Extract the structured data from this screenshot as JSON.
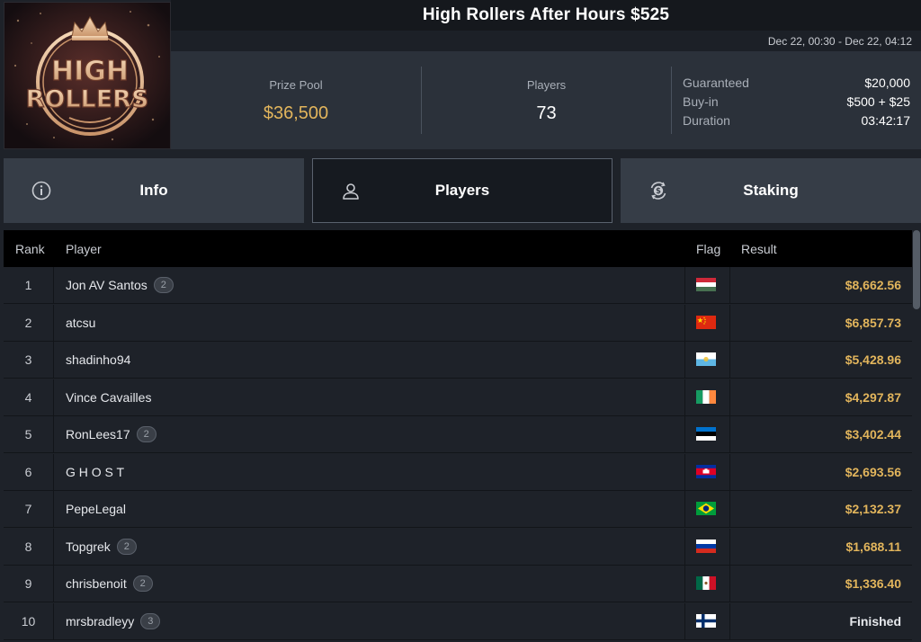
{
  "logo": {
    "text_line1": "HIGH",
    "text_line2": "ROLLERS",
    "alt": "High Rollers logo"
  },
  "header": {
    "title": "High Rollers After Hours $525",
    "dates": "Dec 22, 00:30 - Dec 22, 04:12"
  },
  "stats": {
    "prize_pool_label": "Prize Pool",
    "prize_pool_value": "$36,500",
    "players_label": "Players",
    "players_value": "73",
    "guaranteed_label": "Guaranteed",
    "guaranteed_value": "$20,000",
    "buyin_label": "Buy-in",
    "buyin_value": "$500 + $25",
    "duration_label": "Duration",
    "duration_value": "03:42:17"
  },
  "tabs": [
    {
      "label": "Info",
      "icon": "info-icon"
    },
    {
      "label": "Players",
      "icon": "user-icon",
      "active": true
    },
    {
      "label": "Staking",
      "icon": "staking-icon"
    }
  ],
  "table": {
    "columns": {
      "rank": "Rank",
      "player": "Player",
      "flag": "Flag",
      "result": "Result"
    },
    "rows": [
      {
        "rank": "1",
        "player": "Jon AV Santos",
        "badge": "2",
        "flag": "hungary",
        "result": "$8,662.56"
      },
      {
        "rank": "2",
        "player": "atcsu",
        "badge": "",
        "flag": "china",
        "result": "$6,857.73"
      },
      {
        "rank": "3",
        "player": "shadinho94",
        "badge": "",
        "flag": "san-marino",
        "result": "$5,428.96"
      },
      {
        "rank": "4",
        "player": "Vince Cavailles",
        "badge": "",
        "flag": "ireland",
        "result": "$4,297.87"
      },
      {
        "rank": "5",
        "player": "RonLees17",
        "badge": "2",
        "flag": "estonia",
        "result": "$3,402.44"
      },
      {
        "rank": "6",
        "player": "G H O S T",
        "badge": "",
        "flag": "cambodia",
        "result": "$2,693.56"
      },
      {
        "rank": "7",
        "player": "PepeLegal",
        "badge": "",
        "flag": "brazil",
        "result": "$2,132.37"
      },
      {
        "rank": "8",
        "player": "Topgrek",
        "badge": "2",
        "flag": "russia",
        "result": "$1,688.11"
      },
      {
        "rank": "9",
        "player": "chrisbenoit",
        "badge": "2",
        "flag": "mexico",
        "result": "$1,336.40"
      },
      {
        "rank": "10",
        "player": "mrsbradleyy",
        "badge": "3",
        "flag": "finland",
        "result": "Finished"
      }
    ]
  },
  "colors": {
    "accent_gold": "#e2b55c",
    "background": "#1e2229",
    "panel": "#2b313a",
    "tab": "#363d47"
  }
}
